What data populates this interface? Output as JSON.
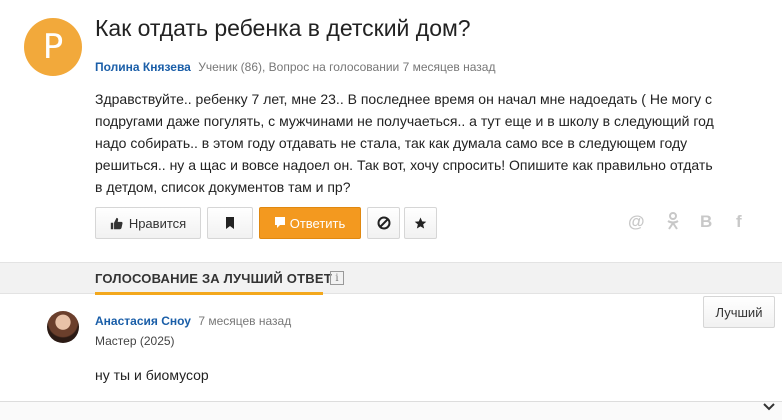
{
  "question": {
    "avatar_letter": "P",
    "title": "Как отдать ребенка в детский дом?",
    "author": "Полина Князева",
    "meta_rest": "Ученик (86), Вопрос на голосовании 7 месяцев назад",
    "body_lines": [
      "Здравствуйте.. ребенку 7 лет, мне 23.. В последнее время он начал мне надоедать ( Не могу с",
      "подругами даже погулять, с мужчинами не получаеться.. а тут еще и в школу в следующий год",
      "надо собирать.. в этом году отдавать не стала, так как думала само все в следующем году",
      "решиться.. ну а щас и вовсе надоел он. Так вот, хочу спросить! Опишите как правильно отдать",
      "в детдом, список документов там и пр?"
    ]
  },
  "actions": {
    "like_label": "Нравится",
    "answer_label": "Ответить"
  },
  "social": {
    "at": "@",
    "ok": "ok-icon",
    "vk": "B",
    "fb": "f"
  },
  "section": {
    "label": "ГОЛОСОВАНИЕ ЗА ЛУЧШИЙ ОТВЕТ",
    "info": "i"
  },
  "answer": {
    "author": "Анастасия Сноу",
    "time": "7 месяцев назад",
    "rank": "Мастер (2025)",
    "text": "ну ты и биомусор",
    "best_label": "Лучший"
  },
  "colors": {
    "accent": "#f3991f",
    "link": "#1a5ea8",
    "avatar": "#f2a93b"
  }
}
